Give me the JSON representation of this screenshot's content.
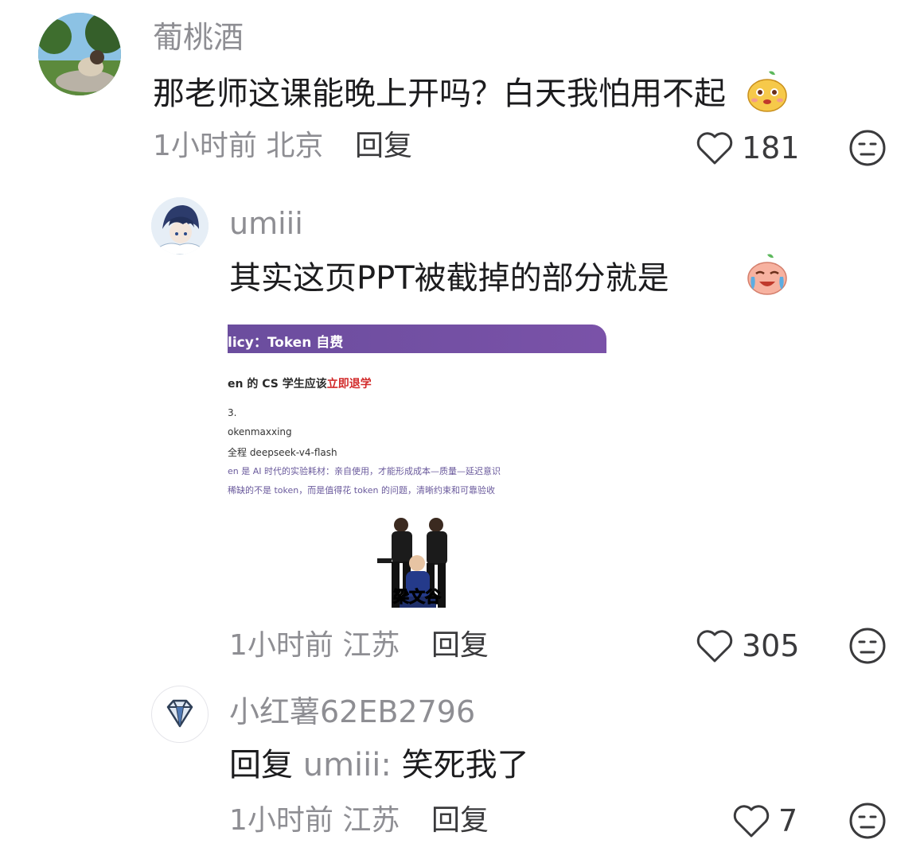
{
  "comments": [
    {
      "username": "葡桃酒",
      "text": "那老师这课能晚上开吗？白天我怕用不起",
      "time": "1小时前",
      "location": "北京",
      "reply_label": "回复",
      "likes": "181",
      "emoji": "pear-face-emoji"
    },
    {
      "username": "umiii",
      "text": "其实这页PPT被截掉的部分就是",
      "time": "1小时前",
      "location": "江苏",
      "reply_label": "回复",
      "likes": "305",
      "emoji": "crying-laughing-peach-emoji",
      "image": {
        "bar_title": "licy：Token 自费",
        "heading_prefix": "en 的 CS 学生应该",
        "heading_red": "立即退学",
        "line1": "3.",
        "line2": "okenmaxxing",
        "line3": "全程 deepseek-v4-flash",
        "line4": "en 是 AI 时代的实验耗材：亲自使用，才能形成成本—质量—延迟意识",
        "line5": "稀缺的不是 token，而是值得花 token 的问题，清晰约束和可靠验收",
        "caption": "梁文谷"
      }
    },
    {
      "username": "小红薯62EB2796",
      "reply_prefix": "回复",
      "mention": "umiii:",
      "text": "笑死我了",
      "time": "1小时前",
      "location": "江苏",
      "reply_label": "回复",
      "likes": "7"
    }
  ]
}
